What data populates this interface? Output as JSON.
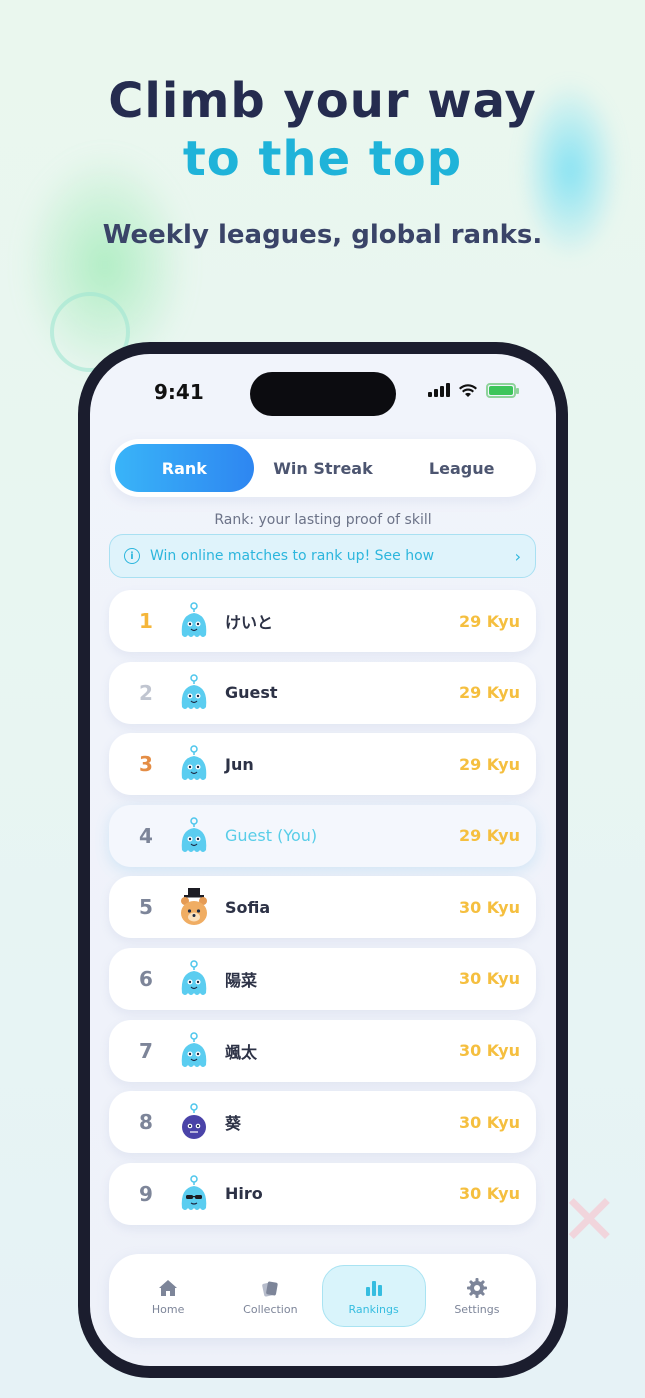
{
  "promo": {
    "headline_line1": "Climb your way",
    "headline_line2": "to the top",
    "subline": "Weekly leagues, global ranks."
  },
  "status_bar": {
    "time": "9:41"
  },
  "tabs": [
    {
      "label": "Rank",
      "active": true
    },
    {
      "label": "Win Streak",
      "active": false
    },
    {
      "label": "League",
      "active": false
    }
  ],
  "caption": "Rank: your lasting proof of skill",
  "info_banner": {
    "icon": "info-icon",
    "text": "Win online matches to rank up! See how",
    "chevron": "›"
  },
  "rankings": [
    {
      "rank": "1",
      "name": "けいと",
      "score": "29 Kyu",
      "avatar": "blue-blob",
      "medal": "gold"
    },
    {
      "rank": "2",
      "name": "Guest",
      "score": "29 Kyu",
      "avatar": "blue-blob",
      "medal": "silver"
    },
    {
      "rank": "3",
      "name": "Jun",
      "score": "29 Kyu",
      "avatar": "blue-blob",
      "medal": "bronze"
    },
    {
      "rank": "4",
      "name": "Guest (You)",
      "score": "29 Kyu",
      "avatar": "blue-blob",
      "medal": "none",
      "is_me": true
    },
    {
      "rank": "5",
      "name": "Sofia",
      "score": "30 Kyu",
      "avatar": "bear-top-hat",
      "medal": "none"
    },
    {
      "rank": "6",
      "name": "陽菜",
      "score": "30 Kyu",
      "avatar": "blue-blob",
      "medal": "none"
    },
    {
      "rank": "7",
      "name": "颯太",
      "score": "30 Kyu",
      "avatar": "blue-blob",
      "medal": "none"
    },
    {
      "rank": "8",
      "name": "葵",
      "score": "30 Kyu",
      "avatar": "purple-ball",
      "medal": "none"
    },
    {
      "rank": "9",
      "name": "Hiro",
      "score": "30 Kyu",
      "avatar": "blue-blob-sunglasses",
      "medal": "none"
    }
  ],
  "bottom_nav": [
    {
      "label": "Home",
      "icon": "home-icon",
      "active": false
    },
    {
      "label": "Collection",
      "icon": "collection-icon",
      "active": false
    },
    {
      "label": "Rankings",
      "icon": "rankings-icon",
      "active": true
    },
    {
      "label": "Settings",
      "icon": "gear-icon",
      "active": false
    }
  ],
  "colors": {
    "accent": "#2e86f1",
    "headline_dark": "#252c4f",
    "headline_cyan": "#1fb3d9",
    "score": "#f5bf3f",
    "gold": "#f5b63a",
    "bronze": "#e48d45"
  }
}
